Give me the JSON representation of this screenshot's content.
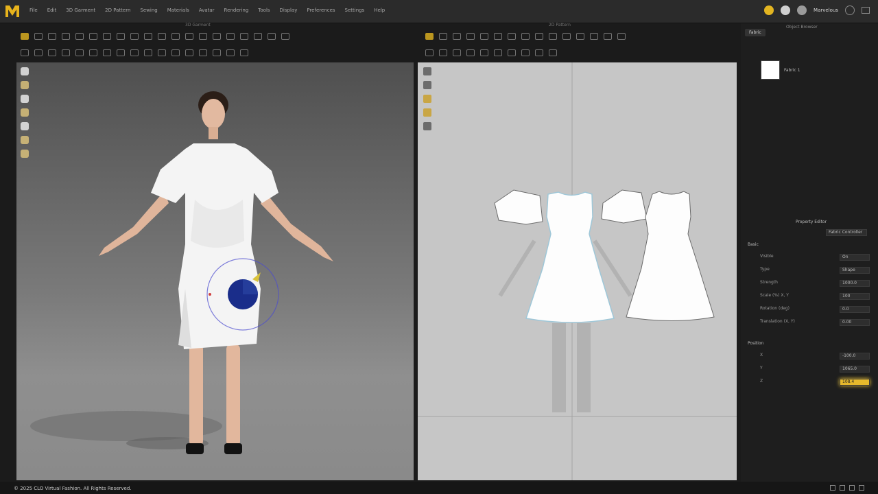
{
  "app": {
    "logo_letter": "M"
  },
  "menu": [
    "File",
    "Edit",
    "3D Garment",
    "2D Pattern",
    "Sewing",
    "Materials",
    "Avatar",
    "Rendering",
    "Tools",
    "Display",
    "Preferences",
    "Settings",
    "Help"
  ],
  "user": {
    "name": "Marvelous"
  },
  "panels": {
    "left_title": "3D Garment",
    "right_title": "2D Pattern"
  },
  "right_panel": {
    "tab_active": "Fabric",
    "tab_other": "Object Browser",
    "fabric_item": "Fabric 1",
    "property_editor_title": "Property Editor",
    "property_editor_dropdown": "Fabric Controller",
    "section_basic": "Basic",
    "rows_basic": [
      {
        "label": "Visible",
        "value": "On"
      },
      {
        "label": "Type",
        "value": "Shape"
      },
      {
        "label": "Strength",
        "value": "1000.0"
      },
      {
        "label": "Scale (%) X, Y",
        "value": "100"
      },
      {
        "label": "Rotation (deg)",
        "value": "0.0"
      },
      {
        "label": "Translation (X, Y)",
        "value": "0.00"
      }
    ],
    "section_position": "Position",
    "rows_position": [
      {
        "label": "X",
        "value": "-100.0"
      },
      {
        "label": "Y",
        "value": "1065.0"
      },
      {
        "label": "Z",
        "value": "108.4"
      }
    ]
  },
  "footer": {
    "text": "© 2025 CLO Virtual Fashion. All Rights Reserved."
  },
  "colors": {
    "accent": "#e3b521",
    "gizmo": "#1a2d8a"
  }
}
